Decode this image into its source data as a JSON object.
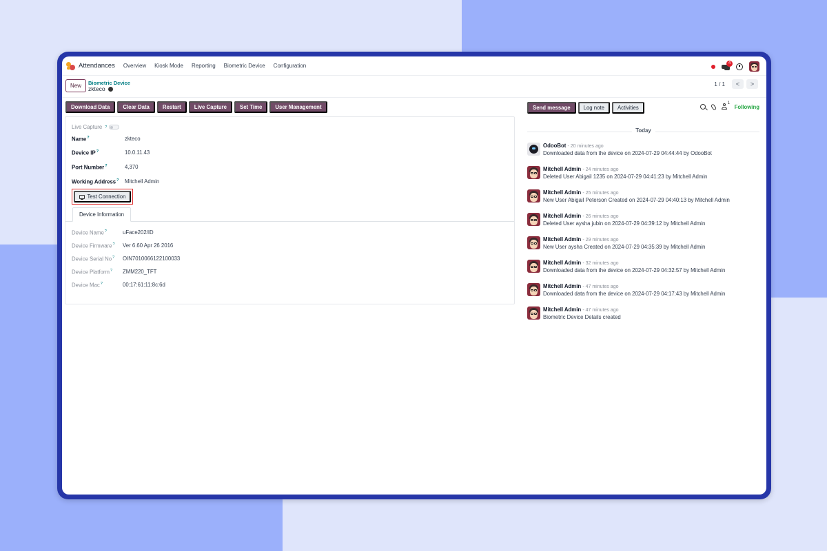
{
  "nav": {
    "app_name": "Attendances",
    "items": [
      "Overview",
      "Kiosk Mode",
      "Reporting",
      "Biometric Device",
      "Configuration"
    ],
    "chat_badge": "4",
    "icons": [
      "recording-dot-icon",
      "chat-icon",
      "clock-icon",
      "user-avatar"
    ]
  },
  "breadcrumb": {
    "new_label": "New",
    "parent": "Biometric Device",
    "current": "zkteco"
  },
  "pager": {
    "text": "1 / 1",
    "prev": "<",
    "next": ">"
  },
  "actions": [
    "Download Data",
    "Clear Data",
    "Restart",
    "Live Capture",
    "Set Time",
    "User Management"
  ],
  "form": {
    "live_capture_label": "Live Capture",
    "help_mark": "?",
    "fields": [
      {
        "label": "Name",
        "value": "zkteco"
      },
      {
        "label": "Device IP",
        "value": "10.0.11.43"
      },
      {
        "label": "Port Number",
        "value": "4,370"
      },
      {
        "label": "Working Address",
        "value": "Mitchell Admin"
      }
    ],
    "test_connection_label": "Test Connection",
    "tab_label": "Device Information",
    "device_info": [
      {
        "label": "Device Name",
        "value": "uFace202/ID"
      },
      {
        "label": "Device Firmware",
        "value": "Ver 6.60 Apr 26 2016"
      },
      {
        "label": "Device Serial No",
        "value": "OIN7010066122100033"
      },
      {
        "label": "Device Platform",
        "value": "ZMM220_TFT"
      },
      {
        "label": "Device Mac",
        "value": "00:17:61:11:8c:6d"
      }
    ]
  },
  "chatter": {
    "send_message": "Send message",
    "log_note": "Log note",
    "activities": "Activities",
    "followers_count": "1",
    "following": "Following",
    "date_separator": "Today",
    "messages": [
      {
        "author": "OdooBot",
        "time": "- 20 minutes ago",
        "body": "Downloaded data from the device on 2024-07-29 04:44:44 by OdooBot",
        "avatar": "bot"
      },
      {
        "author": "Mitchell Admin",
        "time": "- 24 minutes ago",
        "body": "Deleted User Abigail 1235 on 2024-07-29 04:41:23 by Mitchell Admin",
        "avatar": "admin"
      },
      {
        "author": "Mitchell Admin",
        "time": "- 25 minutes ago",
        "body": "New User Abigail Peterson Created on 2024-07-29 04:40:13 by Mitchell Admin",
        "avatar": "admin"
      },
      {
        "author": "Mitchell Admin",
        "time": "- 26 minutes ago",
        "body": "Deleted User aysha jubin on 2024-07-29 04:39:12 by Mitchell Admin",
        "avatar": "admin"
      },
      {
        "author": "Mitchell Admin",
        "time": "- 29 minutes ago",
        "body": "New User aysha Created on 2024-07-29 04:35:39 by Mitchell Admin",
        "avatar": "admin"
      },
      {
        "author": "Mitchell Admin",
        "time": "- 32 minutes ago",
        "body": "Downloaded data from the device on 2024-07-29 04:32:57 by Mitchell Admin",
        "avatar": "admin"
      },
      {
        "author": "Mitchell Admin",
        "time": "- 47 minutes ago",
        "body": "Downloaded data from the device on 2024-07-29 04:17:43 by Mitchell Admin",
        "avatar": "admin"
      },
      {
        "author": "Mitchell Admin",
        "time": "- 47 minutes ago",
        "body": "Biometric Device Details created",
        "avatar": "admin"
      }
    ]
  },
  "colors": {
    "brand": "#714b67",
    "link": "#017e84",
    "following": "#28a745",
    "highlight": "#e02d2d",
    "frame": "#2636a8"
  }
}
